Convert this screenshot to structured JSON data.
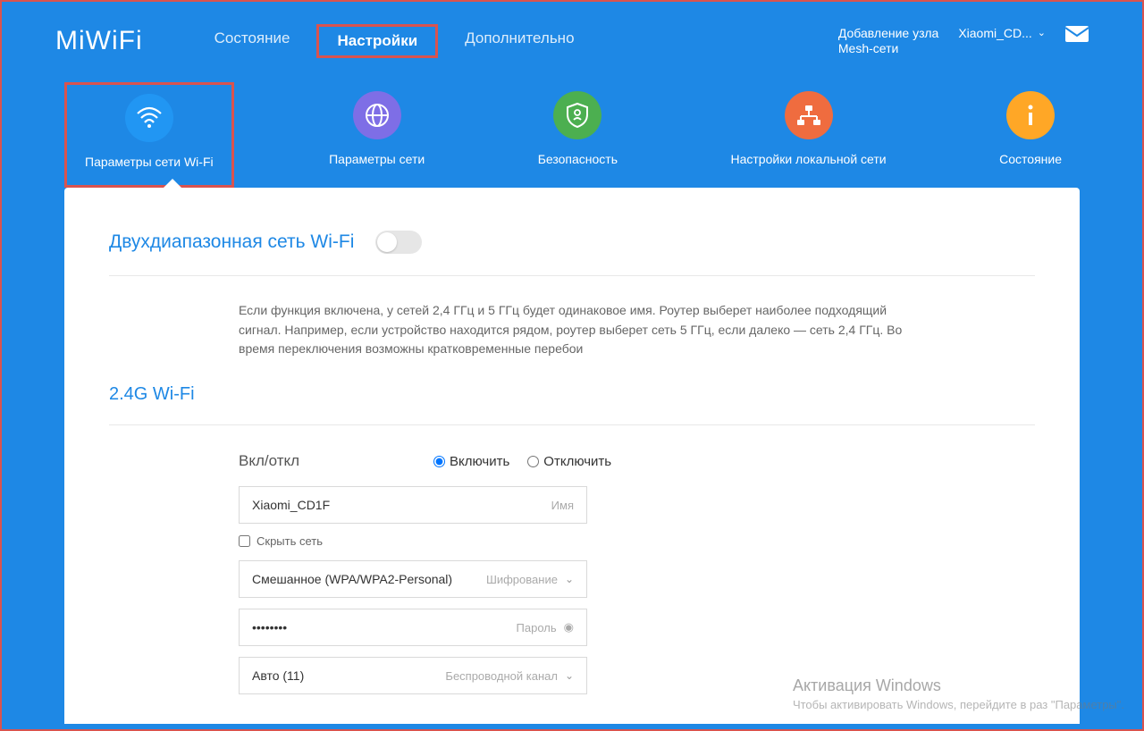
{
  "header": {
    "logo": "MiWiFi",
    "nav": {
      "status": "Состояние",
      "settings": "Настройки",
      "advanced": "Дополнительно"
    },
    "mesh": "Добавление узла\nMesh-сети",
    "device": "Xiaomi_CD..."
  },
  "subnav": {
    "wifi": "Параметры сети Wi-Fi",
    "net": "Параметры сети",
    "sec": "Безопасность",
    "loc": "Настройки локальной сети",
    "info": "Состояние"
  },
  "dualband": {
    "title": "Двухдиапазонная сеть Wi-Fi",
    "desc": "Если функция включена, у сетей 2,4 ГГц и 5 ГГц будет одинаковое имя. Роутер выберет наиболее подходящий сигнал. Например, если устройство находится рядом, роутер выберет сеть 5 ГГц, если далеко — сеть 2,4 ГГц. Во время переключения возможны кратковременные перебои"
  },
  "wifi24": {
    "title": "2.4G Wi-Fi",
    "onoff_label": "Вкл/откл",
    "enable": "Включить",
    "disable": "Отключить",
    "ssid_value": "Xiaomi_CD1F",
    "ssid_hint": "Имя",
    "hide": "Скрыть сеть",
    "enc_value": "Смешанное (WPA/WPA2-Personal)",
    "enc_hint": "Шифрование",
    "pwd_value": "••••••••",
    "pwd_hint": "Пароль",
    "chan_value": "Авто (11)",
    "chan_hint": "Беспроводной канал"
  },
  "watermark": {
    "title": "Активация Windows",
    "body": "Чтобы активировать Windows, перейдите в раз\n\"Параметры\"."
  }
}
